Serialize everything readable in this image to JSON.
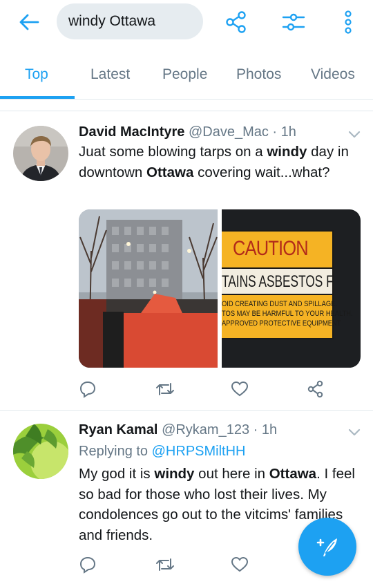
{
  "colors": {
    "accent": "#1da1f2",
    "secondary_text": "#657786",
    "primary_text": "#14171a"
  },
  "search": {
    "query": "windy Ottawa"
  },
  "toolbar": {
    "back_icon": "arrow-left-icon",
    "share_icon": "share-icon",
    "filter_icon": "sliders-icon",
    "more_icon": "more-vertical-icon"
  },
  "tabs": [
    {
      "label": "Top",
      "active": true
    },
    {
      "label": "Latest",
      "active": false
    },
    {
      "label": "People",
      "active": false
    },
    {
      "label": "Photos",
      "active": false
    },
    {
      "label": "Videos",
      "active": false
    }
  ],
  "tweets": [
    {
      "name": "David MacIntyre",
      "handle": "@Dave_Mac",
      "dot": "·",
      "time": "1h",
      "text_parts": [
        "Juat some blowing tarps on a ",
        "windy",
        " day in downtown ",
        "Ottawa",
        " covering wait...what?"
      ],
      "media": [
        {
          "description_icon": "street-photo"
        },
        {
          "caution": "CAUTION",
          "line1": "TAINS ASBESTOS FIBRE",
          "line2": "OID CREATING DUST AND SPILLAGE.",
          "line3": "TOS MAY BE HARMFUL TO YOUR HEALTH.",
          "line4": "APPROVED PROTECTIVE EQUIPMENT"
        }
      ]
    },
    {
      "name": "Ryan Kamal",
      "handle": "@Rykam_123",
      "dot": "·",
      "time": "1h",
      "reply_prefix": "Replying to ",
      "reply_handle": "@HRPSMiltHH",
      "text_parts": [
        "My god it is ",
        "windy",
        " out here in ",
        "Ottawa",
        ". I feel so bad for those who lost their lives. My condolences go out to the vitcims' families and friends."
      ]
    }
  ],
  "fab": {
    "icon": "compose-tweet-icon"
  }
}
